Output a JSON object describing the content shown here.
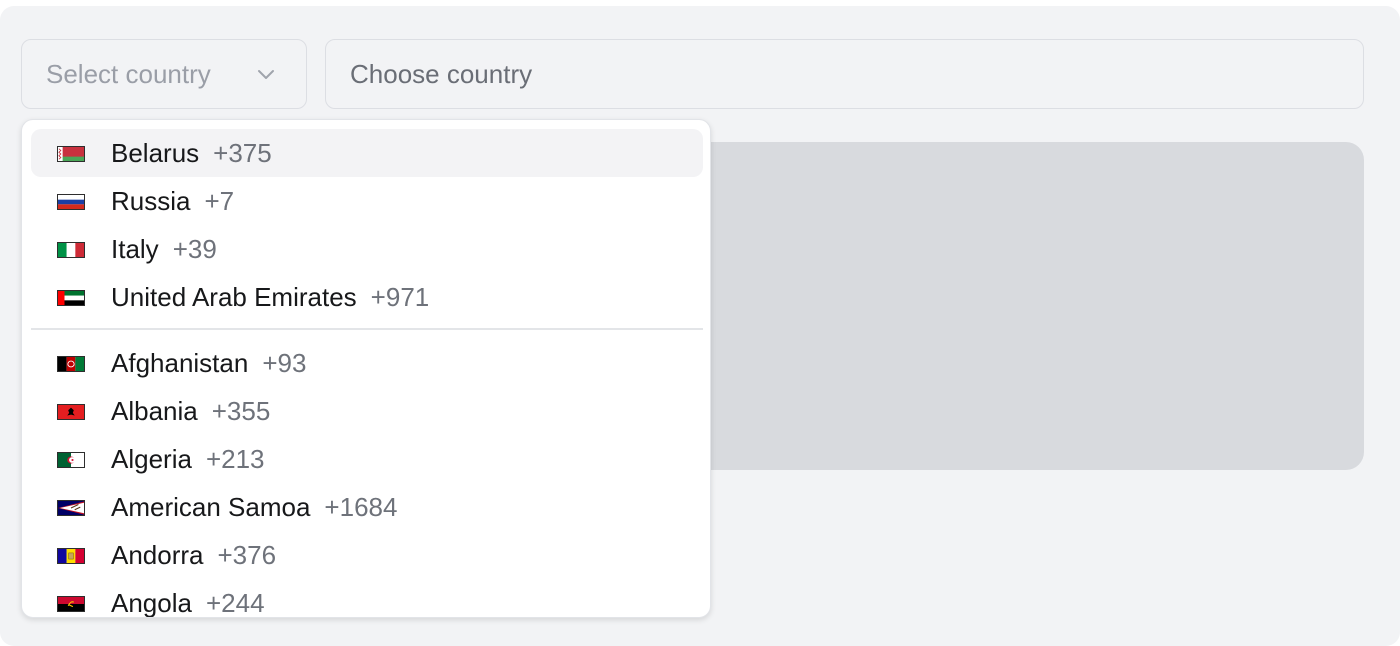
{
  "select": {
    "placeholder": "Select country",
    "chevron_icon": "chevron-down-icon"
  },
  "input": {
    "placeholder": "Choose country",
    "value": ""
  },
  "dropdown": {
    "highlighted_index": 0,
    "pinned": [
      {
        "flag": "belarus-flag-icon",
        "name": "Belarus",
        "code": "+375"
      },
      {
        "flag": "russia-flag-icon",
        "name": "Russia",
        "code": "+7"
      },
      {
        "flag": "italy-flag-icon",
        "name": "Italy",
        "code": "+39"
      },
      {
        "flag": "uae-flag-icon",
        "name": "United Arab Emirates",
        "code": "+971"
      }
    ],
    "all": [
      {
        "flag": "afghanistan-flag-icon",
        "name": "Afghanistan",
        "code": "+93"
      },
      {
        "flag": "albania-flag-icon",
        "name": "Albania",
        "code": "+355"
      },
      {
        "flag": "algeria-flag-icon",
        "name": "Algeria",
        "code": "+213"
      },
      {
        "flag": "american-samoa-flag-icon",
        "name": "American Samoa",
        "code": "+1684"
      },
      {
        "flag": "andorra-flag-icon",
        "name": "Andorra",
        "code": "+376"
      },
      {
        "flag": "angola-flag-icon",
        "name": "Angola",
        "code": "+244"
      }
    ]
  },
  "colors": {
    "background": "#f2f3f5",
    "panel": "#d8dade",
    "highlight": "#f3f3f5",
    "text": "#17181a",
    "muted": "#6e727a"
  }
}
